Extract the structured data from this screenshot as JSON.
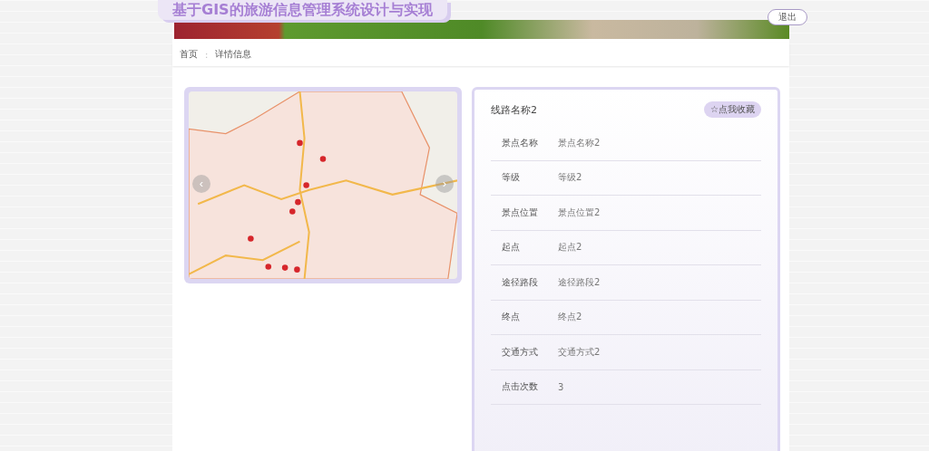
{
  "header": {
    "title": "基于GIS的旅游信息管理系统设计与实现",
    "logout": "退出"
  },
  "breadcrumb": {
    "items": [
      "首页",
      "详情信息"
    ],
    "separator": ":"
  },
  "carousel": {
    "prev": "‹",
    "next": "›"
  },
  "detail": {
    "title": "线路名称2",
    "favorite": "☆点我收藏",
    "rows": [
      {
        "label": "景点名称",
        "value": "景点名称2"
      },
      {
        "label": "等级",
        "value": "等级2"
      },
      {
        "label": "景点位置",
        "value": "景点位置2"
      },
      {
        "label": "起点",
        "value": "起点2"
      },
      {
        "label": "途径路段",
        "value": "途径路段2"
      },
      {
        "label": "终点",
        "value": "终点2"
      },
      {
        "label": "交通方式",
        "value": "交通方式2"
      },
      {
        "label": "点击次数",
        "value": "3"
      }
    ]
  }
}
